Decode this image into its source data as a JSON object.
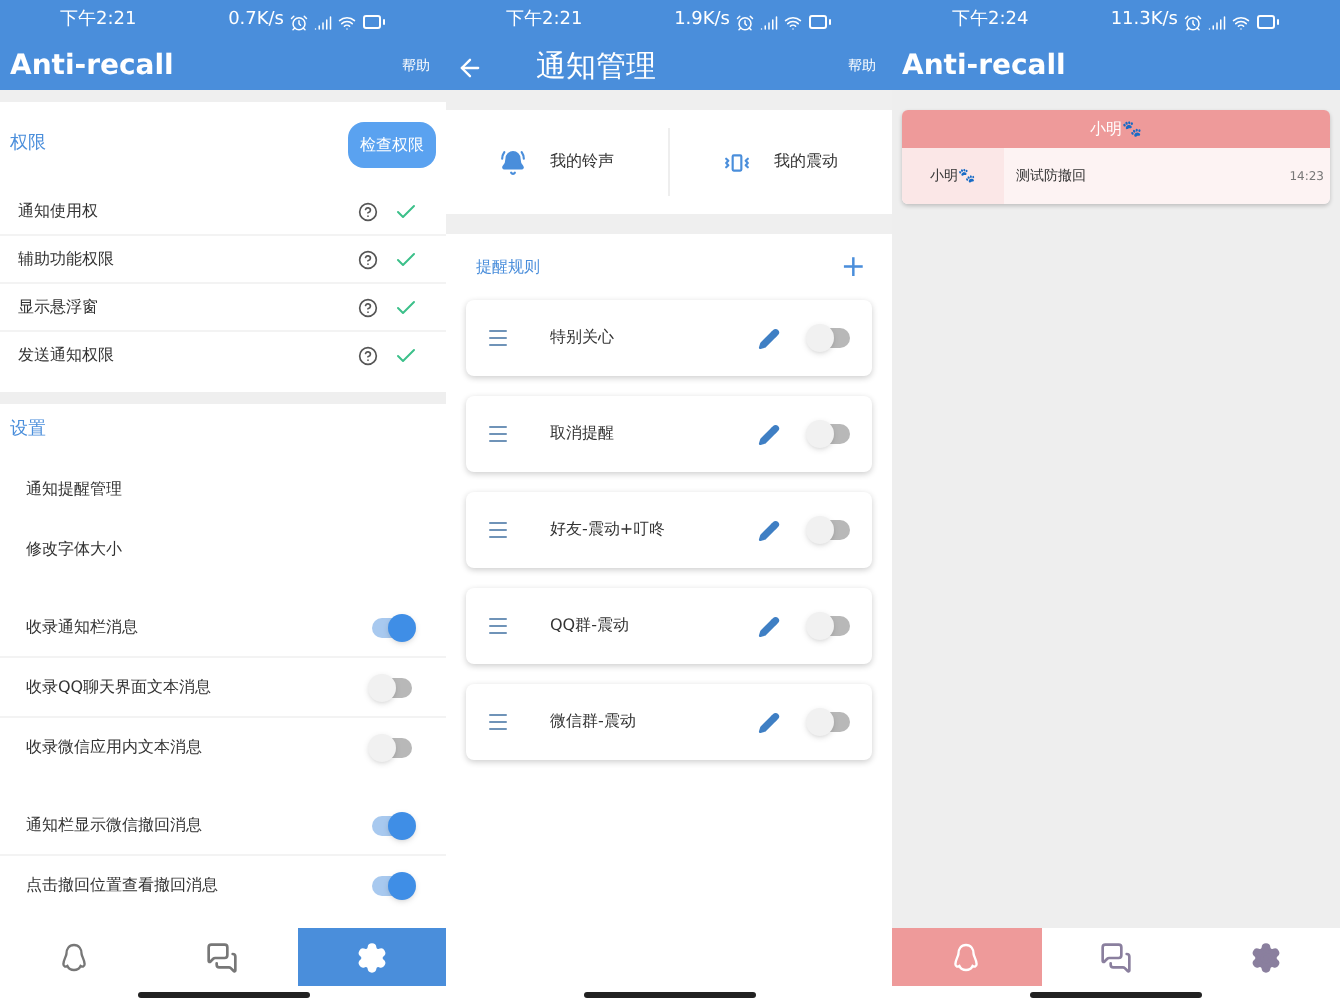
{
  "screens": [
    {
      "kind": "main",
      "status_bar": {
        "time": "下午2:21",
        "speed": "0.7K/s"
      },
      "title": "Anti-recall",
      "help": "帮助",
      "permissions": {
        "heading": "权限",
        "button": "检查权限",
        "items": [
          {
            "label": "通知使用权",
            "checked": true
          },
          {
            "label": "辅助功能权限",
            "checked": true
          },
          {
            "label": "显示悬浮窗",
            "checked": true
          },
          {
            "label": "发送通知权限",
            "checked": true
          }
        ]
      },
      "settings": {
        "heading": "设置",
        "links": [
          "通知提醒管理",
          "修改字体大小"
        ],
        "toggle_groups": [
          [
            {
              "label": "收录通知栏消息",
              "on": true
            },
            {
              "label": "收录QQ聊天界面文本消息",
              "on": false
            },
            {
              "label": "收录微信应用内文本消息",
              "on": false
            }
          ],
          [
            {
              "label": "通知栏显示微信撤回消息",
              "on": true
            },
            {
              "label": "点击撤回位置查看撤回消息",
              "on": true
            }
          ]
        ]
      },
      "nav": [
        {
          "kind": "penguin",
          "selected": false
        },
        {
          "kind": "chat",
          "selected": false
        },
        {
          "kind": "gear",
          "selected": true
        }
      ]
    },
    {
      "kind": "rules",
      "status_bar": {
        "time": "下午2:21",
        "speed": "1.9K/s"
      },
      "title": "通知管理",
      "help": "帮助",
      "shortcuts": [
        {
          "kind": "bell",
          "label": "我的铃声"
        },
        {
          "kind": "vibrate",
          "label": "我的震动"
        }
      ],
      "rules_heading": "提醒规则",
      "add": "+",
      "rules": [
        {
          "label": "特别关心",
          "on": false
        },
        {
          "label": "取消提醒",
          "on": false
        },
        {
          "label": "好友-震动+叮咚",
          "on": false
        },
        {
          "label": "QQ群-震动",
          "on": false
        },
        {
          "label": "微信群-震动",
          "on": false
        }
      ]
    },
    {
      "kind": "messages",
      "status_bar": {
        "time": "下午2:24",
        "speed": "11.3K/s"
      },
      "title": "Anti-recall",
      "conversations": [
        {
          "header": "小明🐾",
          "messages": [
            {
              "sender": "小明🐾",
              "text": "测试防撤回",
              "time": "14:23"
            }
          ]
        }
      ],
      "nav": [
        {
          "kind": "penguin",
          "selected": true
        },
        {
          "kind": "chat",
          "selected": false
        },
        {
          "kind": "gear",
          "selected": false
        }
      ]
    }
  ]
}
